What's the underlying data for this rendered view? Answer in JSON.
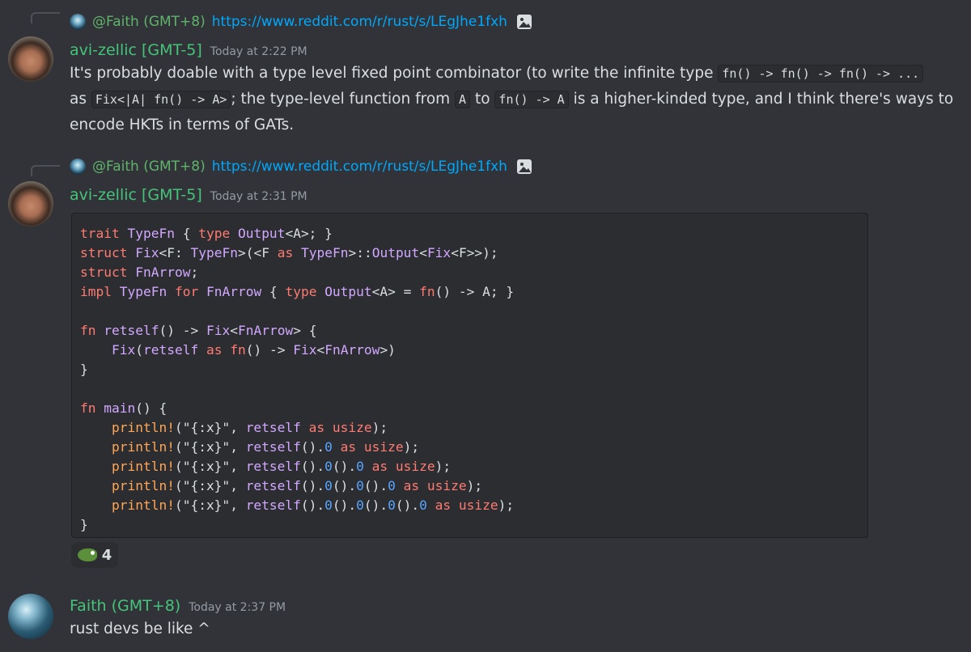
{
  "messages": [
    {
      "reply": {
        "name": "@Faith (GMT+8)",
        "link": "https://www.reddit.com/r/rust/s/LEgJhe1fxh"
      },
      "author": "avi-zellic [GMT-5]",
      "timestamp": "Today at 2:22 PM",
      "body": {
        "t1": "It's probably doable with a type level fixed point combinator (to write the infinite type ",
        "c1": "fn() -> fn() -> fn() -> ...",
        "t2": "as ",
        "c2": "Fix<|A| fn() -> A>",
        "t3": "; the type-level function from ",
        "c3": "A",
        "t4": " to ",
        "c4": "fn() -> A",
        "t5": " is a higher-kinded type, and I think there's ways to encode HKTs in terms of GATs."
      }
    },
    {
      "reply": {
        "name": "@Faith (GMT+8)",
        "link": "https://www.reddit.com/r/rust/s/LEgJhe1fxh"
      },
      "author": "avi-zellic [GMT-5]",
      "timestamp": "Today at 2:31 PM",
      "code_lines": [
        "trait TypeFn { type Output<A>; }",
        "struct Fix<F: TypeFn>(<F as TypeFn>::Output<Fix<F>>);",
        "struct FnArrow;",
        "impl TypeFn for FnArrow { type Output<A> = fn() -> A; }",
        "",
        "fn retself() -> Fix<FnArrow> {",
        "    Fix(retself as fn() -> Fix<FnArrow>)",
        "}",
        "",
        "fn main() {",
        "    println!(\"{:x}\", retself as usize);",
        "    println!(\"{:x}\", retself().0 as usize);",
        "    println!(\"{:x}\", retself().0().0 as usize);",
        "    println!(\"{:x}\", retself().0().0().0 as usize);",
        "    println!(\"{:x}\", retself().0().0().0().0 as usize);",
        "}"
      ],
      "reaction": {
        "emoji": "frog-emoji",
        "count": "4"
      }
    },
    {
      "author": "Faith (GMT+8)",
      "timestamp": "Today at 2:37 PM",
      "text": "rust devs be like ^"
    }
  ],
  "colors": {
    "background": "#313338",
    "code_background": "#2b2d31",
    "username_green": "#45c37a",
    "link_blue": "#00a8fc",
    "keyword": "#ff7b72",
    "type": "#d2a8ff",
    "macro": "#ffa657",
    "number": "#58a6ff"
  }
}
